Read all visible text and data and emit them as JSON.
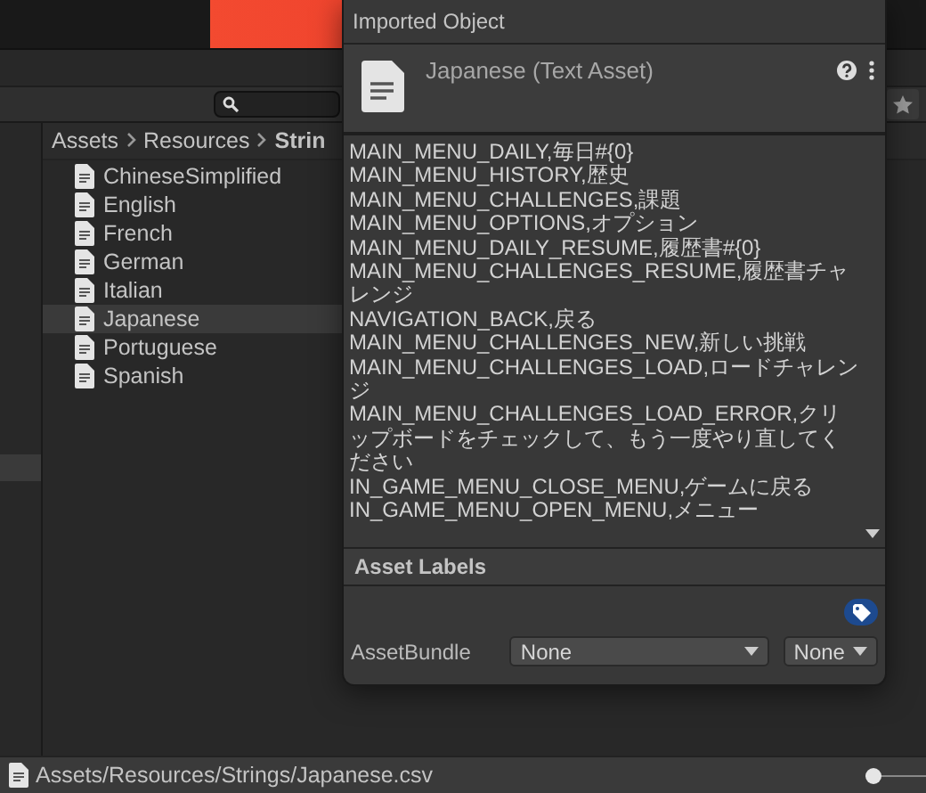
{
  "breadcrumb": [
    "Assets",
    "Resources",
    "Strin"
  ],
  "files": [
    {
      "name": "ChineseSimplified",
      "selected": false
    },
    {
      "name": "English",
      "selected": false
    },
    {
      "name": "French",
      "selected": false
    },
    {
      "name": "German",
      "selected": false
    },
    {
      "name": "Italian",
      "selected": false
    },
    {
      "name": "Japanese",
      "selected": true
    },
    {
      "name": "Portuguese",
      "selected": false
    },
    {
      "name": "Spanish",
      "selected": false
    }
  ],
  "status_bar": {
    "path": "Assets/Resources/Strings/Japanese.csv",
    "zoom_slider": {
      "level": 0
    }
  },
  "inspector": {
    "title": "Imported Object",
    "asset_title": "Japanese (Text Asset)",
    "text_lines": [
      "MAIN_MENU_DAILY,毎日#{0}",
      "MAIN_MENU_HISTORY,歴史",
      "MAIN_MENU_CHALLENGES,課題",
      "MAIN_MENU_OPTIONS,オプション",
      "MAIN_MENU_DAILY_RESUME,履歴書#{0}",
      "MAIN_MENU_CHALLENGES_RESUME,履歴書チャレンジ",
      "NAVIGATION_BACK,戻る",
      "MAIN_MENU_CHALLENGES_NEW,新しい挑戦",
      "MAIN_MENU_CHALLENGES_LOAD,ロードチャレンジ",
      "MAIN_MENU_CHALLENGES_LOAD_ERROR,クリップボードをチェックして、もう一度やり直してください",
      "IN_GAME_MENU_CLOSE_MENU,ゲームに戻る",
      "IN_GAME_MENU_OPEN_MENU,メニュー"
    ],
    "labels_header": "Asset Labels",
    "asset_bundle": {
      "label": "AssetBundle",
      "name": "None",
      "variant": "None"
    }
  }
}
